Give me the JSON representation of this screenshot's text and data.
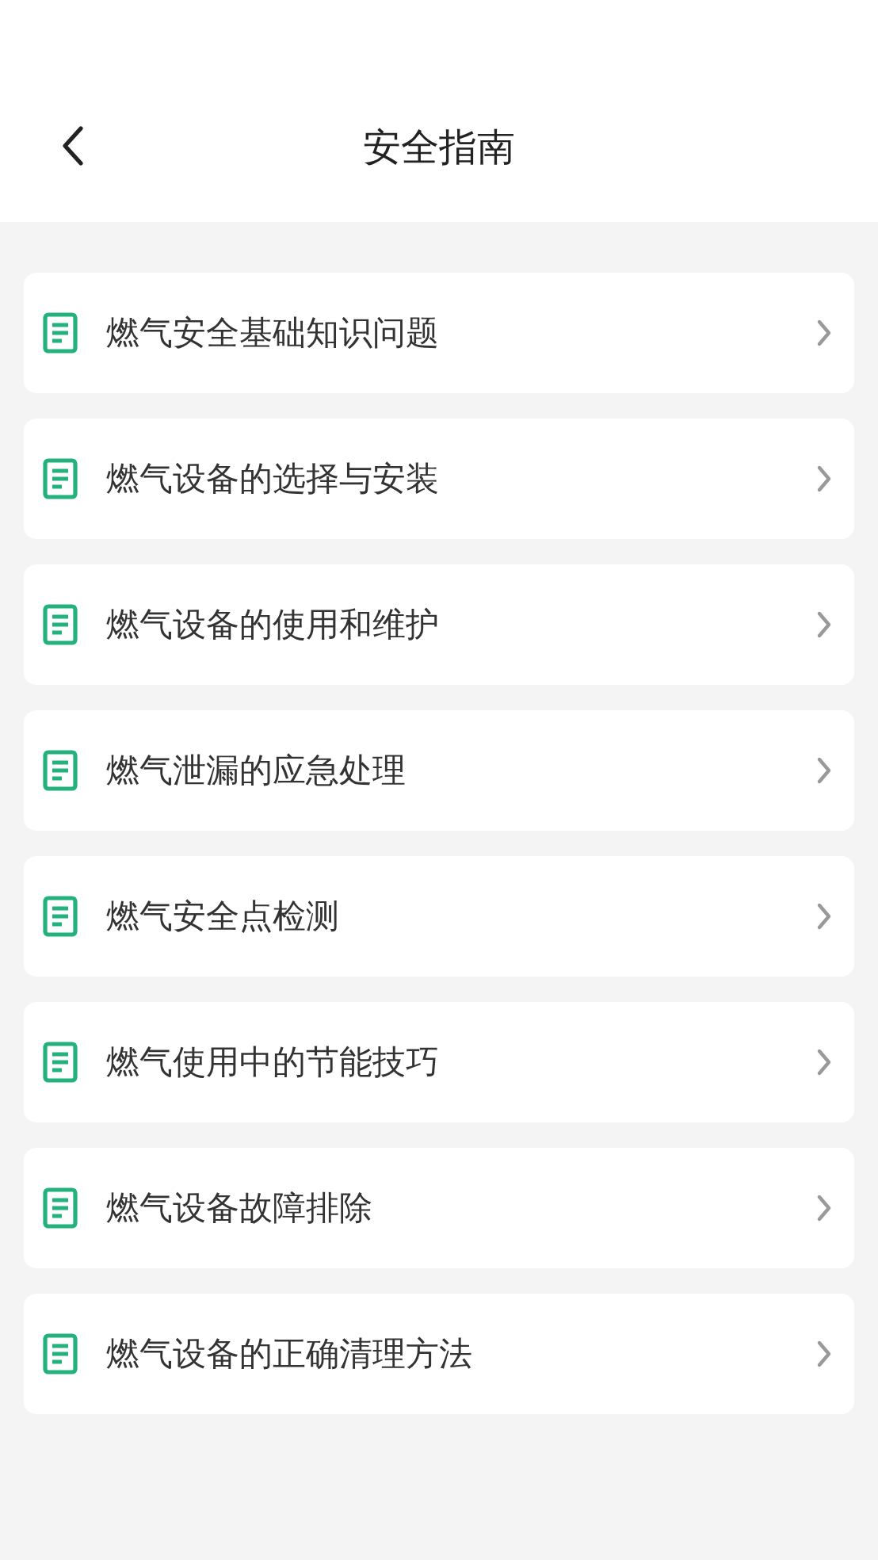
{
  "header": {
    "title": "安全指南"
  },
  "items": [
    {
      "label": "燃气安全基础知识问题"
    },
    {
      "label": "燃气设备的选择与安装"
    },
    {
      "label": "燃气设备的使用和维护"
    },
    {
      "label": "燃气泄漏的应急处理"
    },
    {
      "label": "燃气安全点检测"
    },
    {
      "label": "燃气使用中的节能技巧"
    },
    {
      "label": "燃气设备故障排除"
    },
    {
      "label": "燃气设备的正确清理方法"
    }
  ]
}
